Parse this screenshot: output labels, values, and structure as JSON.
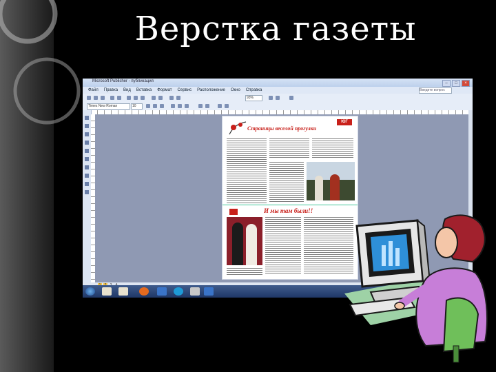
{
  "slide": {
    "title": "Верстка газеты"
  },
  "app": {
    "window_title": "Microsoft Publisher - публикация",
    "menu": [
      "Файл",
      "Правка",
      "Вид",
      "Вставка",
      "Формат",
      "Сервис",
      "Расположение",
      "Окно",
      "Справка"
    ],
    "help_placeholder": "Введите вопрос",
    "zoom": "93%",
    "font_field": "Times New Roman",
    "size_field": "10",
    "page_numbers": [
      "1",
      "2",
      "3",
      "4"
    ]
  },
  "newspaper": {
    "logo": "ЮГ",
    "heading_top": "Страницы веселой прогулки",
    "heading_bottom": "И мы там были!!"
  },
  "colors": {
    "title": "#ffffff",
    "window_frame": "#bcd0ec",
    "workspace": "#8f99b3",
    "accent_red": "#c8201a",
    "divider_green": "#42c89a",
    "taskbar": "#1f3766"
  },
  "icons": [
    "firefox-icon",
    "publisher-icon",
    "skype-icon",
    "word-icon",
    "folder-icon",
    "start-icon"
  ]
}
